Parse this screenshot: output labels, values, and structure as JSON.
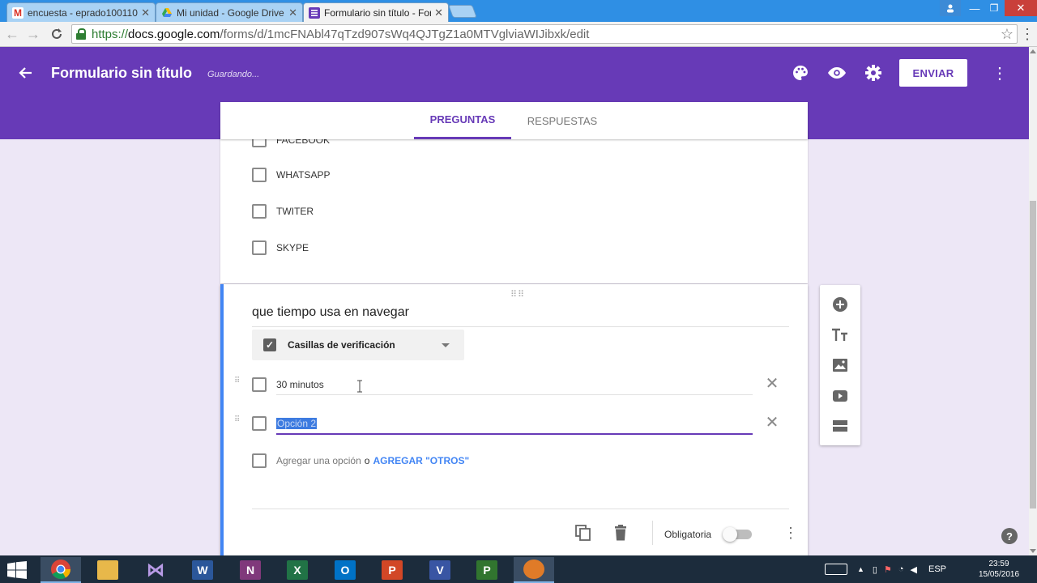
{
  "browser": {
    "tabs": [
      {
        "label": "encuesta - eprado100110",
        "icon": "gmail-icon",
        "color": "#d93025"
      },
      {
        "label": "Mi unidad - Google Drive",
        "icon": "drive-icon",
        "color": "#34a853"
      },
      {
        "label": "Formulario sin título - For",
        "icon": "forms-icon",
        "color": "#673ab7"
      }
    ],
    "url_scheme": "https://",
    "url_host": "docs.google.com",
    "url_path": "/forms/d/1mcFNAbl47qTzd907sWq4QJTgZ1a0MTVglviaWIJibxk/edit"
  },
  "header": {
    "title": "Formulario sin título",
    "status": "Guardando...",
    "send_label": "ENVIAR",
    "color": "#673ab7"
  },
  "form_tabs": {
    "questions": "PREGUNTAS",
    "responses": "RESPUESTAS"
  },
  "previous_question": {
    "options": [
      "FACEBOOK",
      "WHATSAPP",
      "TWITER",
      "SKYPE"
    ]
  },
  "current_question": {
    "title": "que tiempo usa en navegar",
    "type": "Casillas de verificación",
    "options": [
      "30 minutos",
      "Opción 2"
    ],
    "add_option": "Agregar una opción",
    "add_or": "o",
    "add_other": "AGREGAR \"OTROS\"",
    "required_label": "Obligatoria"
  },
  "taskbar": {
    "lang": "ESP",
    "time": "23:59",
    "date": "15/05/2016"
  }
}
